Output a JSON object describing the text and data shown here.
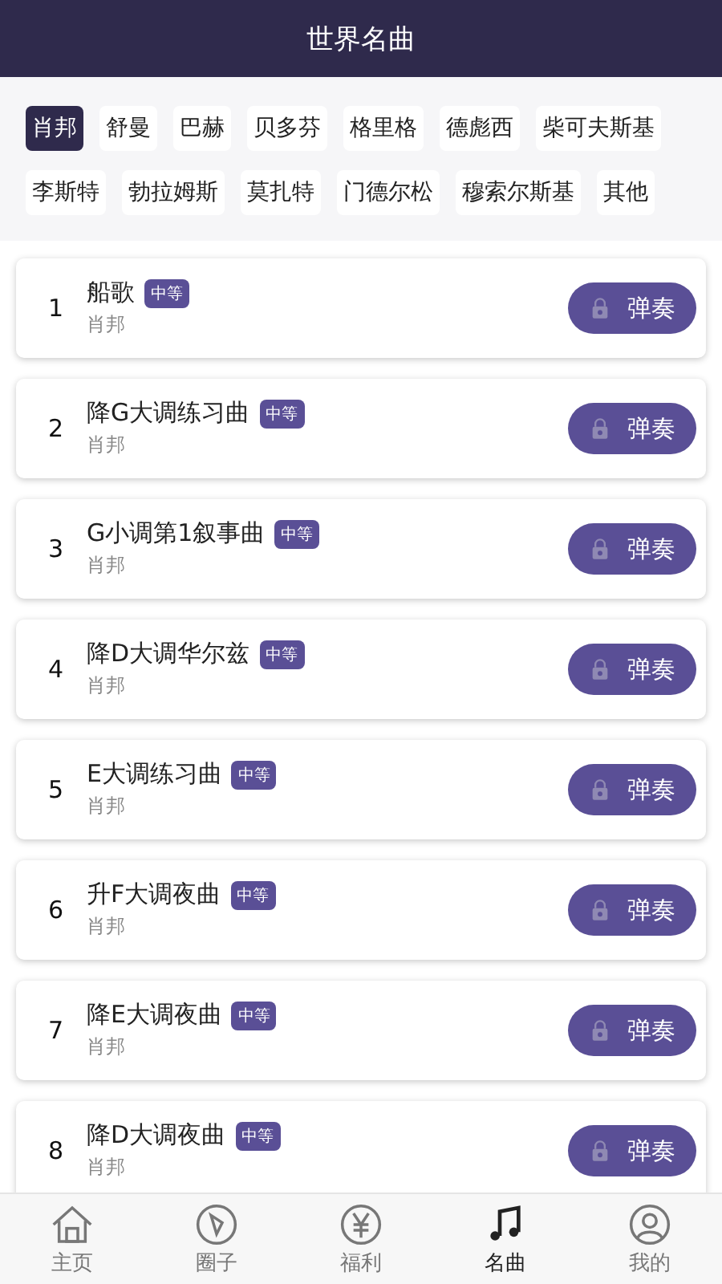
{
  "header": {
    "title": "世界名曲"
  },
  "composers": [
    {
      "label": "肖邦",
      "selected": true
    },
    {
      "label": "舒曼",
      "selected": false
    },
    {
      "label": "巴赫",
      "selected": false
    },
    {
      "label": "贝多芬",
      "selected": false
    },
    {
      "label": "格里格",
      "selected": false
    },
    {
      "label": "德彪西",
      "selected": false
    },
    {
      "label": "柴可夫斯基",
      "selected": false
    },
    {
      "label": "李斯特",
      "selected": false
    },
    {
      "label": "勃拉姆斯",
      "selected": false
    },
    {
      "label": "莫扎特",
      "selected": false
    },
    {
      "label": "门德尔松",
      "selected": false
    },
    {
      "label": "穆索尔斯基",
      "selected": false
    },
    {
      "label": "其他",
      "selected": false
    }
  ],
  "songs": [
    {
      "index": "1",
      "title": "船歌",
      "level": "中等",
      "composer": "肖邦",
      "button": "弹奏",
      "locked": true
    },
    {
      "index": "2",
      "title": "降G大调练习曲",
      "level": "中等",
      "composer": "肖邦",
      "button": "弹奏",
      "locked": true
    },
    {
      "index": "3",
      "title": "G小调第1叙事曲",
      "level": "中等",
      "composer": "肖邦",
      "button": "弹奏",
      "locked": true
    },
    {
      "index": "4",
      "title": "降D大调华尔兹",
      "level": "中等",
      "composer": "肖邦",
      "button": "弹奏",
      "locked": true
    },
    {
      "index": "5",
      "title": "E大调练习曲",
      "level": "中等",
      "composer": "肖邦",
      "button": "弹奏",
      "locked": true
    },
    {
      "index": "6",
      "title": "升F大调夜曲",
      "level": "中等",
      "composer": "肖邦",
      "button": "弹奏",
      "locked": true
    },
    {
      "index": "7",
      "title": "降E大调夜曲",
      "level": "中等",
      "composer": "肖邦",
      "button": "弹奏",
      "locked": true
    },
    {
      "index": "8",
      "title": "降D大调夜曲",
      "level": "中等",
      "composer": "肖邦",
      "button": "弹奏",
      "locked": true
    }
  ],
  "nav": [
    {
      "label": "主页",
      "kind": "home",
      "selected": false
    },
    {
      "label": "圈子",
      "kind": "compass",
      "selected": false
    },
    {
      "label": "福利",
      "kind": "yen",
      "selected": false
    },
    {
      "label": "名曲",
      "kind": "music",
      "selected": true
    },
    {
      "label": "我的",
      "kind": "person",
      "selected": false
    }
  ]
}
